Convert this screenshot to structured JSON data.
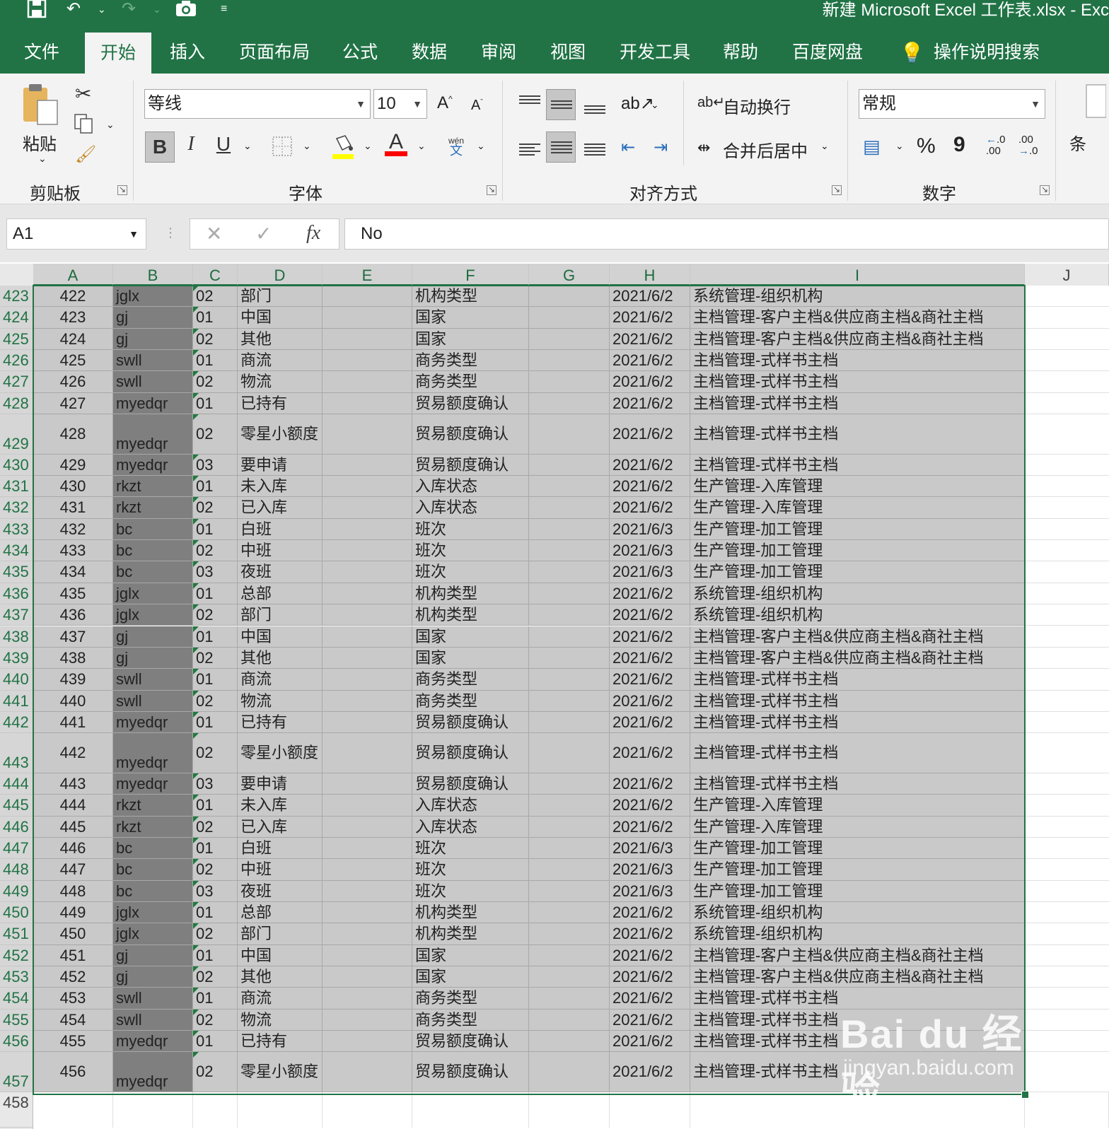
{
  "title_bar": {
    "document_title": "新建 Microsoft Excel 工作表.xlsx  -  Exc"
  },
  "tabs": [
    "文件",
    "开始",
    "插入",
    "页面布局",
    "公式",
    "数据",
    "审阅",
    "视图",
    "开发工具",
    "帮助",
    "百度网盘"
  ],
  "active_tab": "开始",
  "tell_me": "操作说明搜索",
  "ribbon": {
    "clipboard": {
      "paste_label": "粘贴",
      "group_label": "剪贴板"
    },
    "font": {
      "font_name": "等线",
      "font_size": "10",
      "group_label": "字体",
      "bold": "B",
      "italic": "I",
      "underline": "U",
      "font_color_glyph": "A",
      "grow": "A",
      "shrink": "A",
      "phonetic_top": "wén",
      "phonetic_bottom": "文"
    },
    "alignment": {
      "wrap_text": "自动换行",
      "merge_center": "合并后居中",
      "group_label": "对齐方式"
    },
    "number": {
      "format": "常规",
      "group_label": "数字",
      "percent": "%",
      "comma": "9"
    },
    "styles": {
      "partial_label": "条"
    }
  },
  "formula_bar": {
    "name_box": "A1",
    "fx": "fx",
    "value": "No"
  },
  "columns": [
    "A",
    "B",
    "C",
    "D",
    "E",
    "F",
    "G",
    "H",
    "I",
    "J"
  ],
  "rows": [
    {
      "row": "423",
      "a": "422",
      "b": "jglx",
      "c": "02",
      "d": "部门",
      "f": "机构类型",
      "h": "2021/6/2",
      "i": "系统管理-组织机构"
    },
    {
      "row": "424",
      "a": "423",
      "b": "gj",
      "c": "01",
      "d": "中国",
      "f": "国家",
      "h": "2021/6/2",
      "i": "主档管理-客户主档&供应商主档&商社主档"
    },
    {
      "row": "425",
      "a": "424",
      "b": "gj",
      "c": "02",
      "d": "其他",
      "f": "国家",
      "h": "2021/6/2",
      "i": "主档管理-客户主档&供应商主档&商社主档"
    },
    {
      "row": "426",
      "a": "425",
      "b": "swll",
      "c": "01",
      "d": "商流",
      "f": "商务类型",
      "h": "2021/6/2",
      "i": "主档管理-式样书主档"
    },
    {
      "row": "427",
      "a": "426",
      "b": "swll",
      "c": "02",
      "d": "物流",
      "f": "商务类型",
      "h": "2021/6/2",
      "i": "主档管理-式样书主档"
    },
    {
      "row": "428",
      "a": "427",
      "b": "myedqr",
      "c": "01",
      "d": "已持有",
      "f": "贸易额度确认",
      "h": "2021/6/2",
      "i": "主档管理-式样书主档"
    },
    {
      "row": "429",
      "a": "428",
      "b": "myedqr",
      "c": "02",
      "d": "零星小额度",
      "f": "贸易额度确认",
      "h": "2021/6/2",
      "i": "主档管理-式样书主档",
      "tall": true
    },
    {
      "row": "430",
      "a": "429",
      "b": "myedqr",
      "c": "03",
      "d": "要申请",
      "f": "贸易额度确认",
      "h": "2021/6/2",
      "i": "主档管理-式样书主档"
    },
    {
      "row": "431",
      "a": "430",
      "b": "rkzt",
      "c": "01",
      "d": "未入库",
      "f": "入库状态",
      "h": "2021/6/2",
      "i": "生产管理-入库管理"
    },
    {
      "row": "432",
      "a": "431",
      "b": "rkzt",
      "c": "02",
      "d": "已入库",
      "f": "入库状态",
      "h": "2021/6/2",
      "i": "生产管理-入库管理"
    },
    {
      "row": "433",
      "a": "432",
      "b": "bc",
      "c": "01",
      "d": "白班",
      "f": "班次",
      "h": "2021/6/3",
      "i": "生产管理-加工管理"
    },
    {
      "row": "434",
      "a": "433",
      "b": "bc",
      "c": "02",
      "d": "中班",
      "f": "班次",
      "h": "2021/6/3",
      "i": "生产管理-加工管理"
    },
    {
      "row": "435",
      "a": "434",
      "b": "bc",
      "c": "03",
      "d": "夜班",
      "f": "班次",
      "h": "2021/6/3",
      "i": "生产管理-加工管理"
    },
    {
      "row": "436",
      "a": "435",
      "b": "jglx",
      "c": "01",
      "d": "总部",
      "f": "机构类型",
      "h": "2021/6/2",
      "i": "系统管理-组织机构"
    },
    {
      "row": "437",
      "a": "436",
      "b": "jglx",
      "c": "02",
      "d": "部门",
      "f": "机构类型",
      "h": "2021/6/2",
      "i": "系统管理-组织机构"
    },
    {
      "row": "438",
      "a": "437",
      "b": "gj",
      "c": "01",
      "d": "中国",
      "f": "国家",
      "h": "2021/6/2",
      "i": "主档管理-客户主档&供应商主档&商社主档"
    },
    {
      "row": "439",
      "a": "438",
      "b": "gj",
      "c": "02",
      "d": "其他",
      "f": "国家",
      "h": "2021/6/2",
      "i": "主档管理-客户主档&供应商主档&商社主档"
    },
    {
      "row": "440",
      "a": "439",
      "b": "swll",
      "c": "01",
      "d": "商流",
      "f": "商务类型",
      "h": "2021/6/2",
      "i": "主档管理-式样书主档"
    },
    {
      "row": "441",
      "a": "440",
      "b": "swll",
      "c": "02",
      "d": "物流",
      "f": "商务类型",
      "h": "2021/6/2",
      "i": "主档管理-式样书主档"
    },
    {
      "row": "442",
      "a": "441",
      "b": "myedqr",
      "c": "01",
      "d": "已持有",
      "f": "贸易额度确认",
      "h": "2021/6/2",
      "i": "主档管理-式样书主档"
    },
    {
      "row": "443",
      "a": "442",
      "b": "myedqr",
      "c": "02",
      "d": "零星小额度",
      "f": "贸易额度确认",
      "h": "2021/6/2",
      "i": "主档管理-式样书主档",
      "tall": true
    },
    {
      "row": "444",
      "a": "443",
      "b": "myedqr",
      "c": "03",
      "d": "要申请",
      "f": "贸易额度确认",
      "h": "2021/6/2",
      "i": "主档管理-式样书主档"
    },
    {
      "row": "445",
      "a": "444",
      "b": "rkzt",
      "c": "01",
      "d": "未入库",
      "f": "入库状态",
      "h": "2021/6/2",
      "i": "生产管理-入库管理"
    },
    {
      "row": "446",
      "a": "445",
      "b": "rkzt",
      "c": "02",
      "d": "已入库",
      "f": "入库状态",
      "h": "2021/6/2",
      "i": "生产管理-入库管理"
    },
    {
      "row": "447",
      "a": "446",
      "b": "bc",
      "c": "01",
      "d": "白班",
      "f": "班次",
      "h": "2021/6/3",
      "i": "生产管理-加工管理"
    },
    {
      "row": "448",
      "a": "447",
      "b": "bc",
      "c": "02",
      "d": "中班",
      "f": "班次",
      "h": "2021/6/3",
      "i": "生产管理-加工管理"
    },
    {
      "row": "449",
      "a": "448",
      "b": "bc",
      "c": "03",
      "d": "夜班",
      "f": "班次",
      "h": "2021/6/3",
      "i": "生产管理-加工管理"
    },
    {
      "row": "450",
      "a": "449",
      "b": "jglx",
      "c": "01",
      "d": "总部",
      "f": "机构类型",
      "h": "2021/6/2",
      "i": "系统管理-组织机构"
    },
    {
      "row": "451",
      "a": "450",
      "b": "jglx",
      "c": "02",
      "d": "部门",
      "f": "机构类型",
      "h": "2021/6/2",
      "i": "系统管理-组织机构"
    },
    {
      "row": "452",
      "a": "451",
      "b": "gj",
      "c": "01",
      "d": "中国",
      "f": "国家",
      "h": "2021/6/2",
      "i": "主档管理-客户主档&供应商主档&商社主档"
    },
    {
      "row": "453",
      "a": "452",
      "b": "gj",
      "c": "02",
      "d": "其他",
      "f": "国家",
      "h": "2021/6/2",
      "i": "主档管理-客户主档&供应商主档&商社主档"
    },
    {
      "row": "454",
      "a": "453",
      "b": "swll",
      "c": "01",
      "d": "商流",
      "f": "商务类型",
      "h": "2021/6/2",
      "i": "主档管理-式样书主档"
    },
    {
      "row": "455",
      "a": "454",
      "b": "swll",
      "c": "02",
      "d": "物流",
      "f": "商务类型",
      "h": "2021/6/2",
      "i": "主档管理-式样书主档"
    },
    {
      "row": "456",
      "a": "455",
      "b": "myedqr",
      "c": "01",
      "d": "已持有",
      "f": "贸易额度确认",
      "h": "2021/6/2",
      "i": "主档管理-式样书主档"
    },
    {
      "row": "457",
      "a": "456",
      "b": "myedqr",
      "c": "02",
      "d": "零星小额度",
      "f": "贸易额度确认",
      "h": "2021/6/2",
      "i": "主档管理-式样书主档",
      "tall": true
    }
  ],
  "next_row": "458",
  "watermark": {
    "logo": "Bai du 经验",
    "url": "jingyan.baidu.com"
  },
  "colors": {
    "accent": "#217346",
    "selection_fill": "#c9c9c9",
    "column_b_fill": "#7f7f7f"
  }
}
